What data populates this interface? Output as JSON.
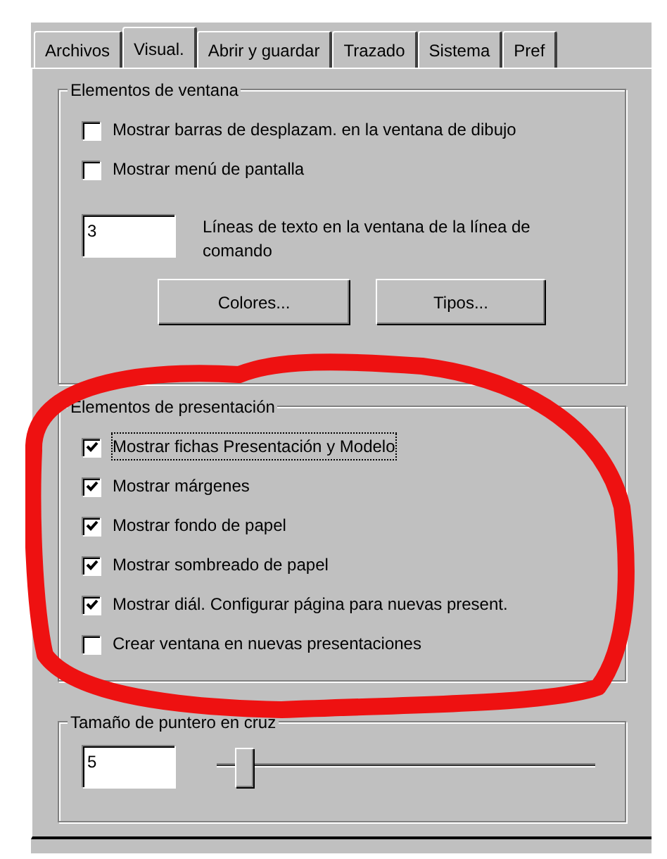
{
  "tabs": [
    {
      "label": "Archivos",
      "selected": false
    },
    {
      "label": "Visual.",
      "selected": true
    },
    {
      "label": "Abrir y guardar",
      "selected": false
    },
    {
      "label": "Trazado",
      "selected": false
    },
    {
      "label": "Sistema",
      "selected": false
    },
    {
      "label": "Pref",
      "selected": false
    }
  ],
  "window_elements": {
    "title": "Elementos de ventana",
    "checkboxes": [
      {
        "label": "Mostrar barras de desplazam. en la ventana de dibujo",
        "checked": false
      },
      {
        "label": "Mostrar menú de pantalla",
        "checked": false
      }
    ],
    "command_lines": {
      "value": "3",
      "label": "Líneas de texto en la ventana de la línea de comando"
    },
    "buttons": [
      "Colores...",
      "Tipos..."
    ]
  },
  "layout_elements": {
    "title": "Elementos de presentación",
    "checkboxes": [
      {
        "label": "Mostrar fichas Presentación y Modelo",
        "checked": true,
        "focused": true
      },
      {
        "label": "Mostrar márgenes",
        "checked": true,
        "focused": false
      },
      {
        "label": "Mostrar fondo de papel",
        "checked": true,
        "focused": false
      },
      {
        "label": "Mostrar sombreado de papel",
        "checked": true,
        "focused": false
      },
      {
        "label": "Mostrar diál. Configurar página para nuevas present.",
        "checked": true,
        "focused": false
      },
      {
        "label": "Crear ventana en nuevas presentaciones",
        "checked": false,
        "focused": false
      }
    ]
  },
  "crosshair_size": {
    "title": "Tamaño de puntero en cruz",
    "value": "5",
    "level": 0.05
  }
}
